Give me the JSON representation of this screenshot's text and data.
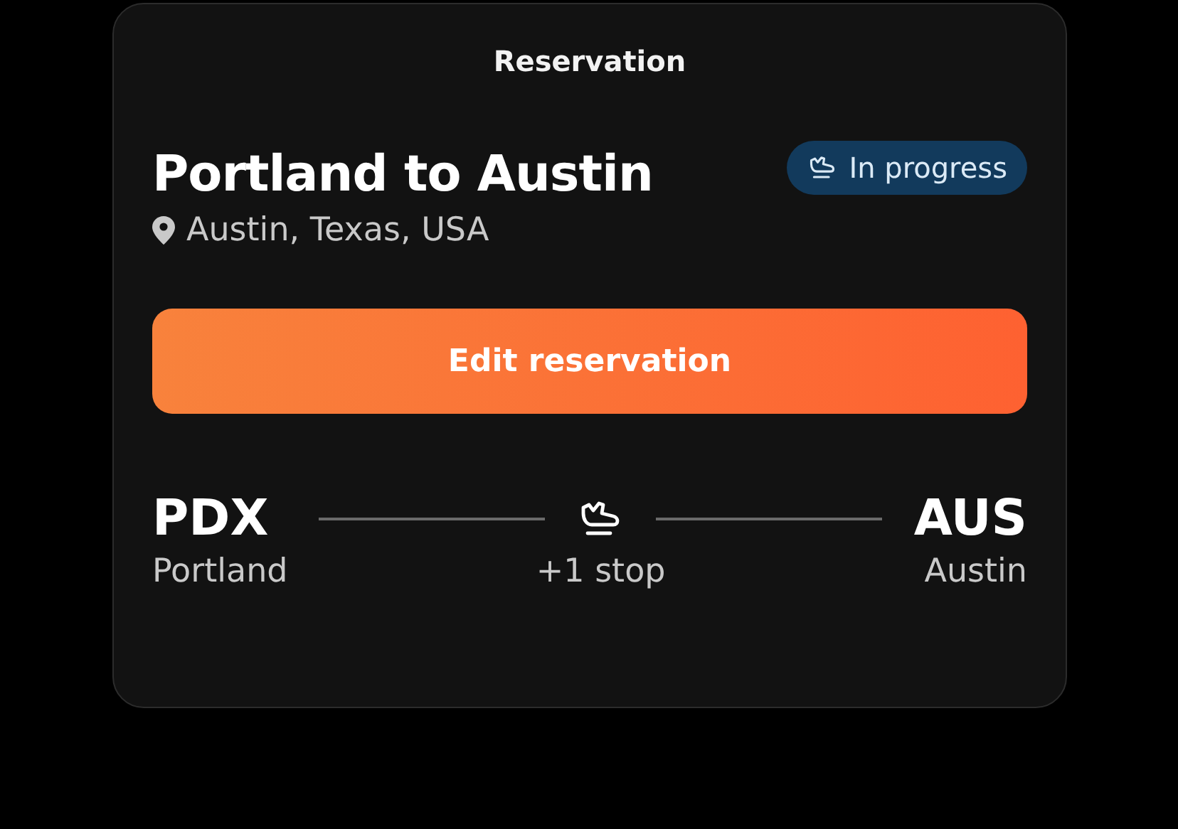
{
  "header": {
    "title": "Reservation"
  },
  "trip": {
    "title": "Portland to Austin",
    "location": "Austin, Texas, USA"
  },
  "status": {
    "kind": "in_progress",
    "label": "In progress"
  },
  "action": {
    "label": "Edit reservation"
  },
  "route": {
    "origin": {
      "code": "PDX",
      "city": "Portland"
    },
    "stops": "+1 stop",
    "destination": {
      "code": "AUS",
      "city": "Austin"
    }
  }
}
